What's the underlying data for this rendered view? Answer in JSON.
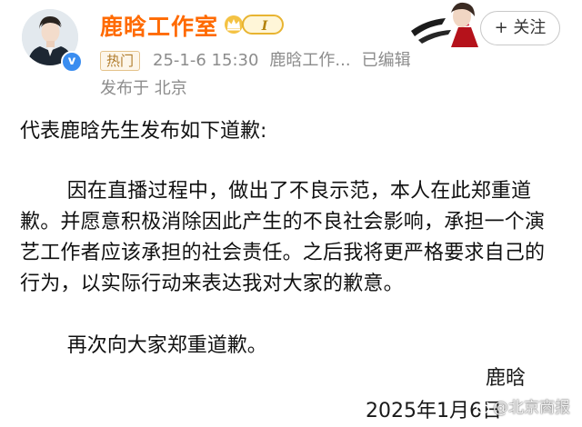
{
  "header": {
    "username": "鹿晗工作室",
    "level_badge": "I",
    "hot_tag": "热门",
    "timestamp": "25-1-6 15:30",
    "source": "鹿晗工作...",
    "edited": "已编辑",
    "location": "发布于 北京",
    "follow_label": "+ 关注",
    "verified_mark": "v"
  },
  "post": {
    "intro": "代表鹿晗先生发布如下道歉:",
    "paragraph1": "因在直播过程中，做出了不良示范，本人在此郑重道歉。并愿意积极消除因此产生的不良社会影响，承担一个演艺工作者应该承担的社会责任。之后我将更严格要求自己的行为，以实际行动来表达我对大家的歉意。",
    "paragraph2": "再次向大家郑重道歉。",
    "signature_name": "鹿晗",
    "signature_date": "2025年1月6日"
  },
  "watermark": "@北京商报",
  "colors": {
    "username": "#ff6a00",
    "meta": "#8c8c8c",
    "verified": "#3a8df0",
    "hot_tag_border": "#e4c28a"
  },
  "icons": {
    "crown": "crown-icon",
    "verified": "verified-icon",
    "weibo": "weibo-icon"
  }
}
